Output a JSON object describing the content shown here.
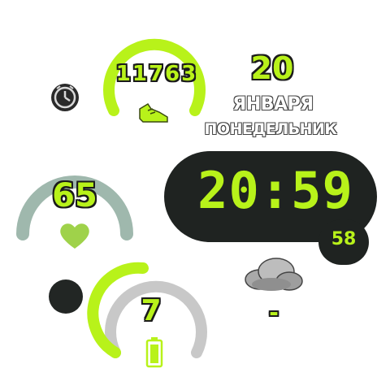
{
  "watchface": {
    "steps": {
      "value": "11763",
      "progress": 0.7
    },
    "date": {
      "day": "20",
      "month": "ЯНВАРЯ",
      "weekday": "ПОНЕДЕЛЬНИК"
    },
    "heart_rate": {
      "value": "65",
      "progress": 0.7
    },
    "time": {
      "hours": "20",
      "minutes": "59",
      "seconds": "58",
      "separator": ":"
    },
    "battery": {
      "value": "7",
      "progress": 0.55
    },
    "weather": {
      "temperature": "-"
    },
    "icons": [
      "alarm-icon",
      "shoe-icon",
      "heart-icon",
      "battery-icon",
      "cloud-icon"
    ],
    "colors": {
      "accent": "#b8f21a",
      "heart_ring": "#9fb8ad",
      "track": "#c8c8c8",
      "panel": "#1f2321"
    }
  }
}
